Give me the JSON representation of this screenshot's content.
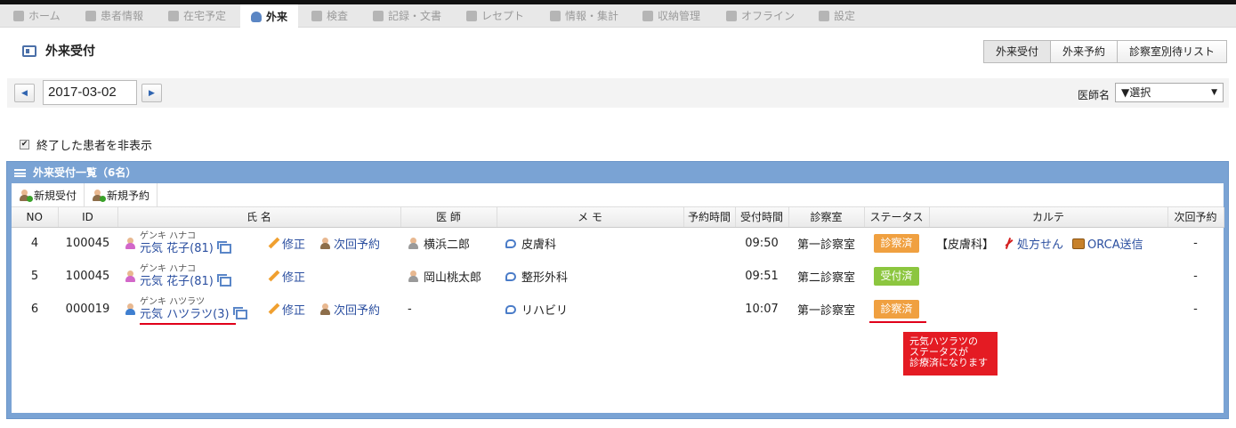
{
  "tabs": [
    {
      "label": "ホーム",
      "icon": "home-icon"
    },
    {
      "label": "患者情報",
      "icon": "patient-icon"
    },
    {
      "label": "在宅予定",
      "icon": "clock-icon"
    },
    {
      "label": "外来",
      "icon": "user-icon"
    },
    {
      "label": "検査",
      "icon": "chart-icon"
    },
    {
      "label": "記録・文書",
      "icon": "document-icon"
    },
    {
      "label": "レセプト",
      "icon": "receipt-icon"
    },
    {
      "label": "情報・集計",
      "icon": "stats-icon"
    },
    {
      "label": "収納管理",
      "icon": "register-icon"
    },
    {
      "label": "オフライン",
      "icon": "offline-icon"
    },
    {
      "label": "設定",
      "icon": "gear-icon"
    }
  ],
  "page": {
    "title": "外来受付"
  },
  "top_buttons": [
    "外来受付",
    "外来予約",
    "診察室別待リスト"
  ],
  "datebar": {
    "date": "2017-03-02",
    "doctor_label": "医師名",
    "doctor_select": "▼選択"
  },
  "hide_finished": {
    "label": "終了した患者を非表示",
    "checked": true
  },
  "list": {
    "title": "外来受付一覧（6名）",
    "toolbar": {
      "new_reception": "新規受付",
      "new_reservation": "新規予約"
    },
    "columns": [
      "NO",
      "ID",
      "氏 名",
      "医 師",
      "メ モ",
      "予約時間",
      "受付時間",
      "診察室",
      "ステータス",
      "カルテ",
      "次回予約"
    ],
    "edit_label": "修正",
    "next_label": "次回予約",
    "rows": [
      {
        "no": "4",
        "id": "100045",
        "kana": "ゲンキ ハナコ",
        "name": "元気 花子(81)",
        "gender": "female",
        "has_next": true,
        "doctor": "横浜二郎",
        "memo": "皮膚科",
        "reserve_time": "",
        "reception_time": "09:50",
        "room": "第一診察室",
        "status": "診察済",
        "status_color": "#f0a040",
        "karte": {
          "dept": "【皮膚科】",
          "prescription": "処方せん",
          "orca": "ORCA送信"
        },
        "next": "-"
      },
      {
        "no": "5",
        "id": "100045",
        "kana": "ゲンキ ハナコ",
        "name": "元気 花子(81)",
        "gender": "female",
        "has_next": false,
        "doctor": "岡山桃太郎",
        "memo": "整形外科",
        "reserve_time": "",
        "reception_time": "09:51",
        "room": "第二診察室",
        "status": "受付済",
        "status_color": "#8cc63f",
        "karte": null,
        "next": "-"
      },
      {
        "no": "6",
        "id": "000019",
        "kana": "ゲンキ ハツラツ",
        "name": "元気 ハツラツ(3)",
        "gender": "male",
        "has_next": true,
        "doctor": "-",
        "memo": "リハビリ",
        "reserve_time": "",
        "reception_time": "10:07",
        "room": "第一診察室",
        "status": "診察済",
        "status_color": "#f0a040",
        "karte": null,
        "next": "-"
      }
    ]
  },
  "annotation": {
    "lines": [
      "元気ハツラツの",
      "ステータスが",
      "診療済になります"
    ],
    "color": "#e41b23"
  }
}
